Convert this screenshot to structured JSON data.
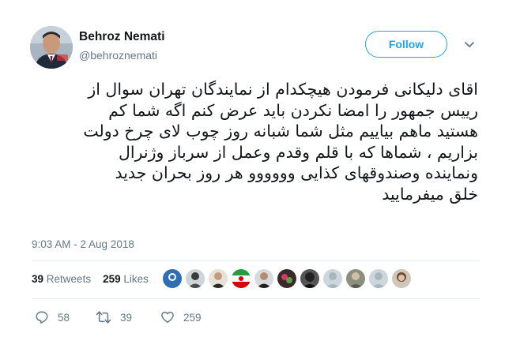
{
  "user": {
    "display_name": "Behroz Nemati",
    "handle": "@behroznemati"
  },
  "follow_button_label": "Follow",
  "tweet_lines": [
    "اقای دلیکانی فرمودن هیچکدام از نمایندگان تهران سوال از",
    "رییس جمهور را امضا نکردن باید عرض کنم اگه شما کم",
    "هستید ماهم بیاییم مثل شما شبانه روز چوب لای چرخ دولت",
    "بزاریم ، شماها که با قلم وقدم وعمل  از سرباز وژنرال",
    "ونماینده وصندوقهای کذایی  وووووو هر روز بحران جدید",
    "خلق میفرمایید"
  ],
  "timestamp": "9:03 AM - 2 Aug 2018",
  "stats": {
    "retweets_count": "39",
    "retweets_label": "Retweets",
    "likes_count": "259",
    "likes_label": "Likes"
  },
  "actions": {
    "replies": "58",
    "retweets": "39",
    "likes": "259"
  },
  "colors": {
    "accent": "#1da1f2",
    "muted_text": "#657786",
    "text": "#14171a",
    "divider": "#e6ecf0"
  },
  "icons": [
    "caret-down-icon",
    "reply-icon",
    "retweet-icon",
    "heart-icon"
  ]
}
